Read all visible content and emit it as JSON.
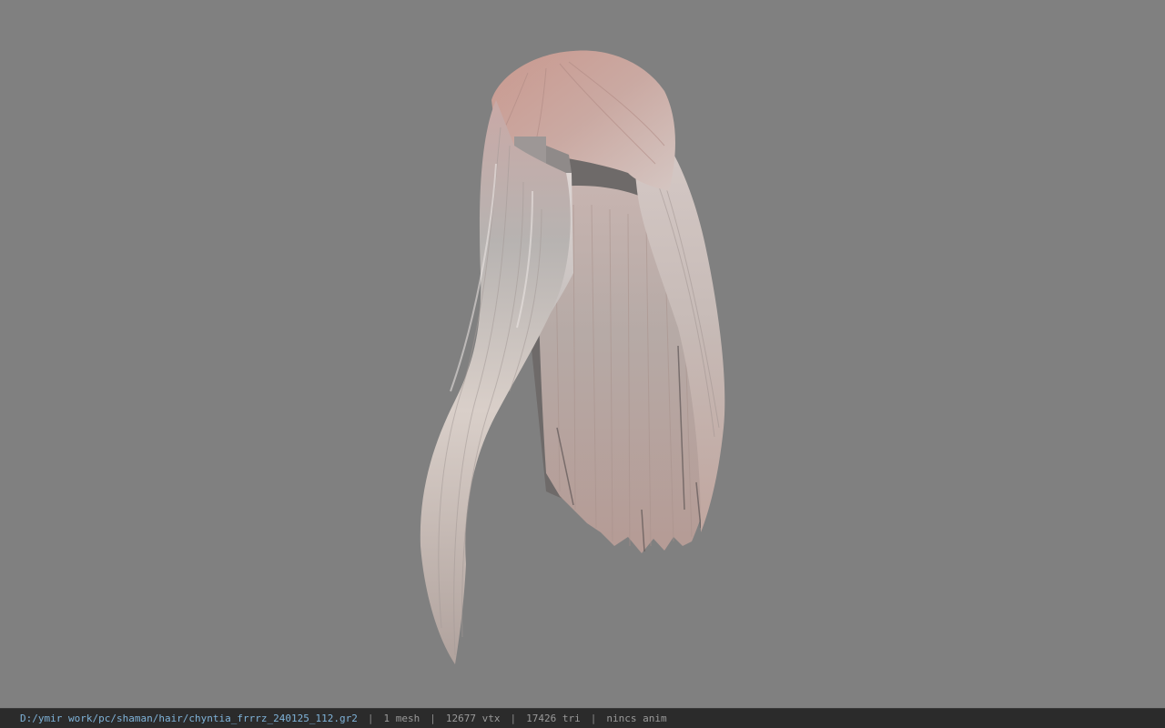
{
  "viewport": {
    "model_name": "hair-mesh",
    "background_color": "#808080"
  },
  "status_bar": {
    "file_path": "D:/ymir work/pc/shaman/hair/chyntia_frrrz_240125_112.gr2",
    "separator": "|",
    "mesh_count": "1 mesh",
    "vertex_count": "12677 vtx",
    "triangle_count": "17426 tri",
    "animation": "nincs anim"
  }
}
